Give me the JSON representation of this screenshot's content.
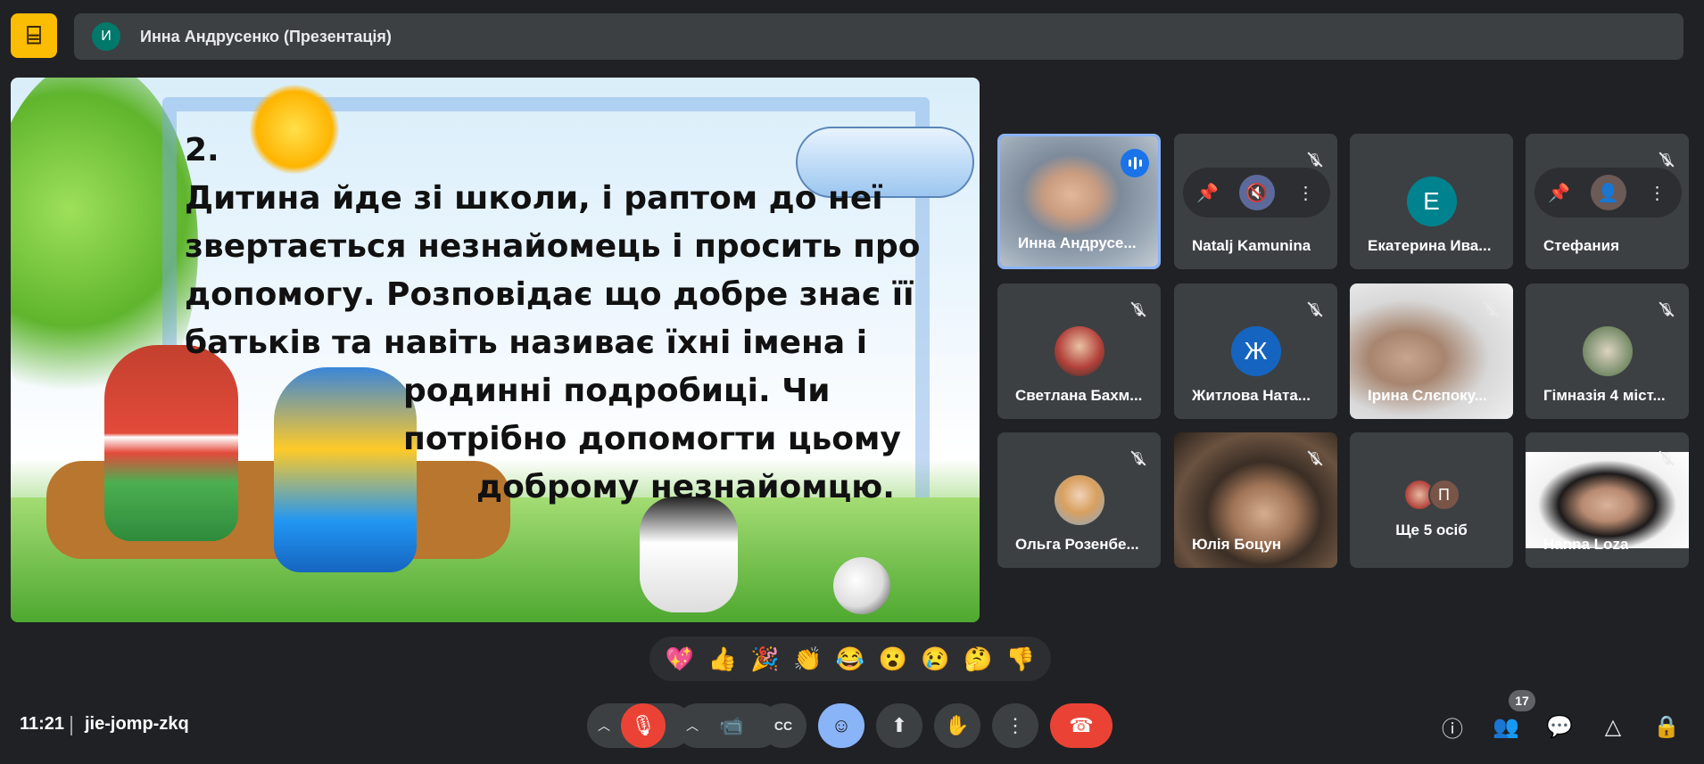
{
  "presenter_bar": {
    "avatar_letter": "И",
    "title": "Инна Андрусенко (Презентація)"
  },
  "slide": {
    "number": "2.",
    "lines": [
      "Дитина йде зі школи, і раптом до неї",
      "звертається незнайомець і просить про",
      "допомогу. Розповідає що добре знає її",
      "батьків та навіть називає їхні імена і",
      "родинні подробиці. Чи",
      "потрібно допомогти цьому",
      "доброму незнайомцю."
    ]
  },
  "participants": [
    {
      "name": "Инна Андрусе...",
      "state": "speaking",
      "type": "video"
    },
    {
      "name": "Natalj Kamunina",
      "state": "muted",
      "type": "hover"
    },
    {
      "name": "Екатерина Ива...",
      "state": "muted-hidden",
      "type": "letter",
      "letter": "Е",
      "color": "#00838f"
    },
    {
      "name": "Стефания",
      "state": "muted",
      "type": "hover"
    },
    {
      "name": "Светлана Бахм...",
      "state": "muted",
      "type": "photo"
    },
    {
      "name": "Житлова Ната...",
      "state": "muted",
      "type": "letter",
      "letter": "Ж",
      "color": "#1565c0"
    },
    {
      "name": "Ірина Слєпоку...",
      "state": "muted",
      "type": "video"
    },
    {
      "name": "Гімназія 4 міст...",
      "state": "muted",
      "type": "photo"
    },
    {
      "name": "Ольга Розенбе...",
      "state": "muted",
      "type": "photo"
    },
    {
      "name": "Юлія Боцун",
      "state": "muted",
      "type": "video"
    },
    {
      "name": "Ще 5 осіб",
      "state": "none",
      "type": "more",
      "letter": "П"
    },
    {
      "name": "Hanna Loza",
      "state": "muted",
      "type": "video"
    }
  ],
  "reactions": [
    "💖",
    "👍",
    "🎉",
    "👏",
    "😂",
    "😮",
    "😢",
    "🤔",
    "👎"
  ],
  "footer": {
    "time": "11:21",
    "meeting_code": "jie-jomp-zkq",
    "participants_count": "17"
  },
  "colors": {
    "background": "#202124",
    "tile": "#3c4043",
    "accent": "#8ab4f8",
    "danger": "#ea4335",
    "logo": "#fbbc04"
  }
}
